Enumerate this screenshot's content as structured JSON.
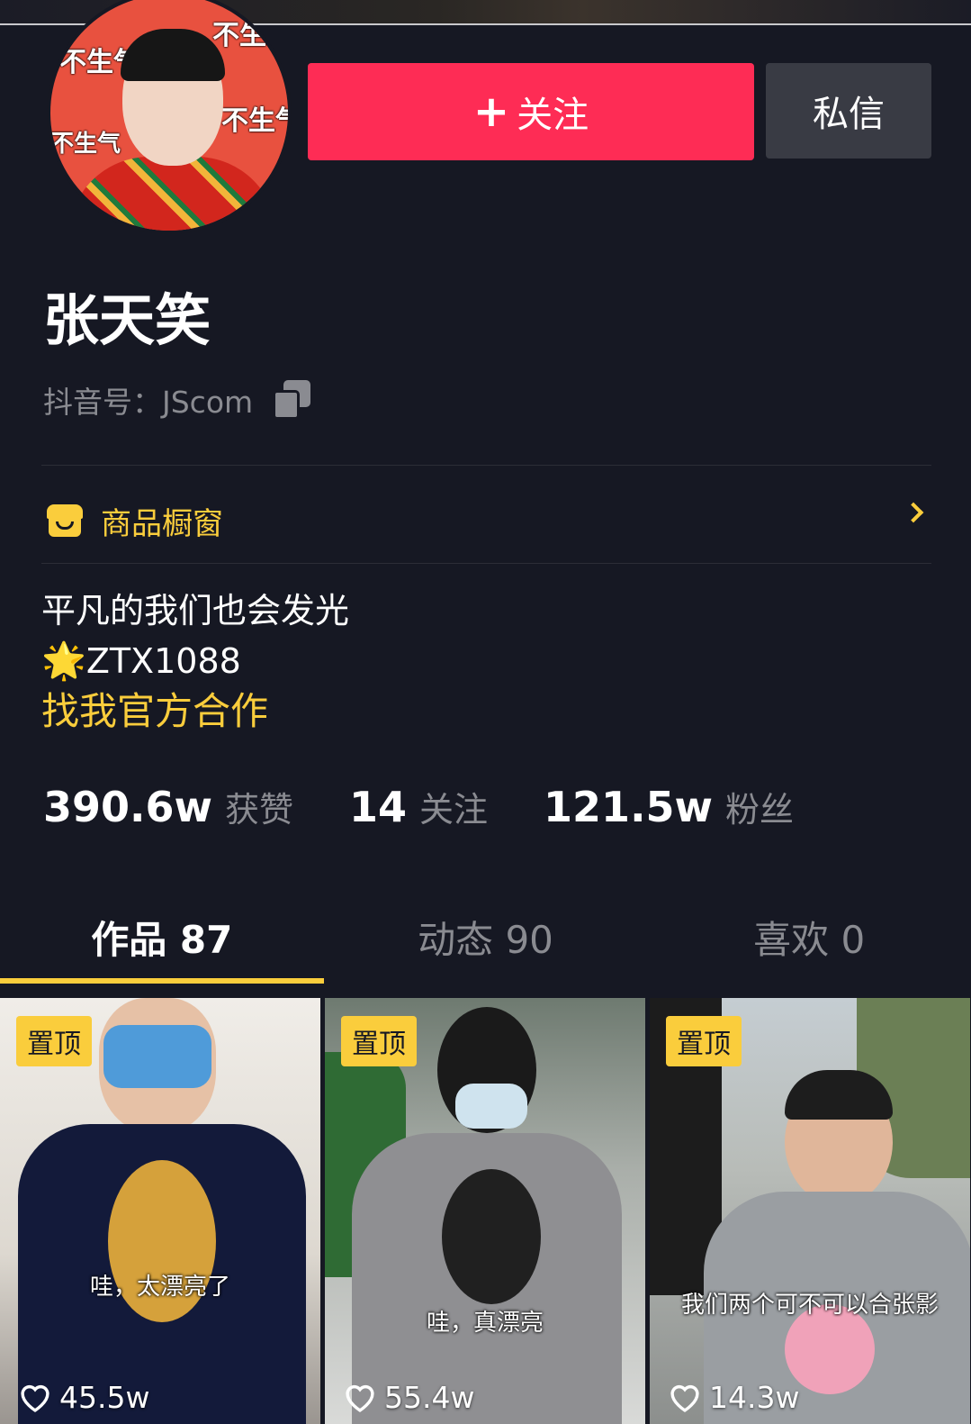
{
  "profile": {
    "name": "张天笑",
    "douyin_id": "抖音号：JScom",
    "avatar_text": "不生气"
  },
  "actions": {
    "follow_plus": "+",
    "follow_label": "关注",
    "message_label": "私信"
  },
  "shop": {
    "label": "商品橱窗"
  },
  "bio": {
    "line1": "平凡的我们也会发光",
    "star": "🌟",
    "line2": "ZTX1088",
    "link": "找我官方合作"
  },
  "stats": [
    {
      "num": "390.6w",
      "label": "获赞"
    },
    {
      "num": "14",
      "label": "关注"
    },
    {
      "num": "121.5w",
      "label": "粉丝"
    }
  ],
  "tabs": [
    {
      "label": "作品 87",
      "active": true
    },
    {
      "label": "动态 90",
      "active": false
    },
    {
      "label": "喜欢 0",
      "active": false
    }
  ],
  "videos": [
    {
      "pin": "置顶",
      "caption": "哇，太漂亮了",
      "likes": "45.5w"
    },
    {
      "pin": "置顶",
      "caption": "哇，真漂亮",
      "likes": "55.4w"
    },
    {
      "pin": "置顶",
      "caption": "我们两个可不可以合张影",
      "likes": "14.3w"
    }
  ],
  "colors": {
    "background": "#161823",
    "follow_button": "#fe2c55",
    "message_button": "#393b44",
    "accent_yellow": "#facd3c",
    "muted_text": "#8a8b91"
  }
}
